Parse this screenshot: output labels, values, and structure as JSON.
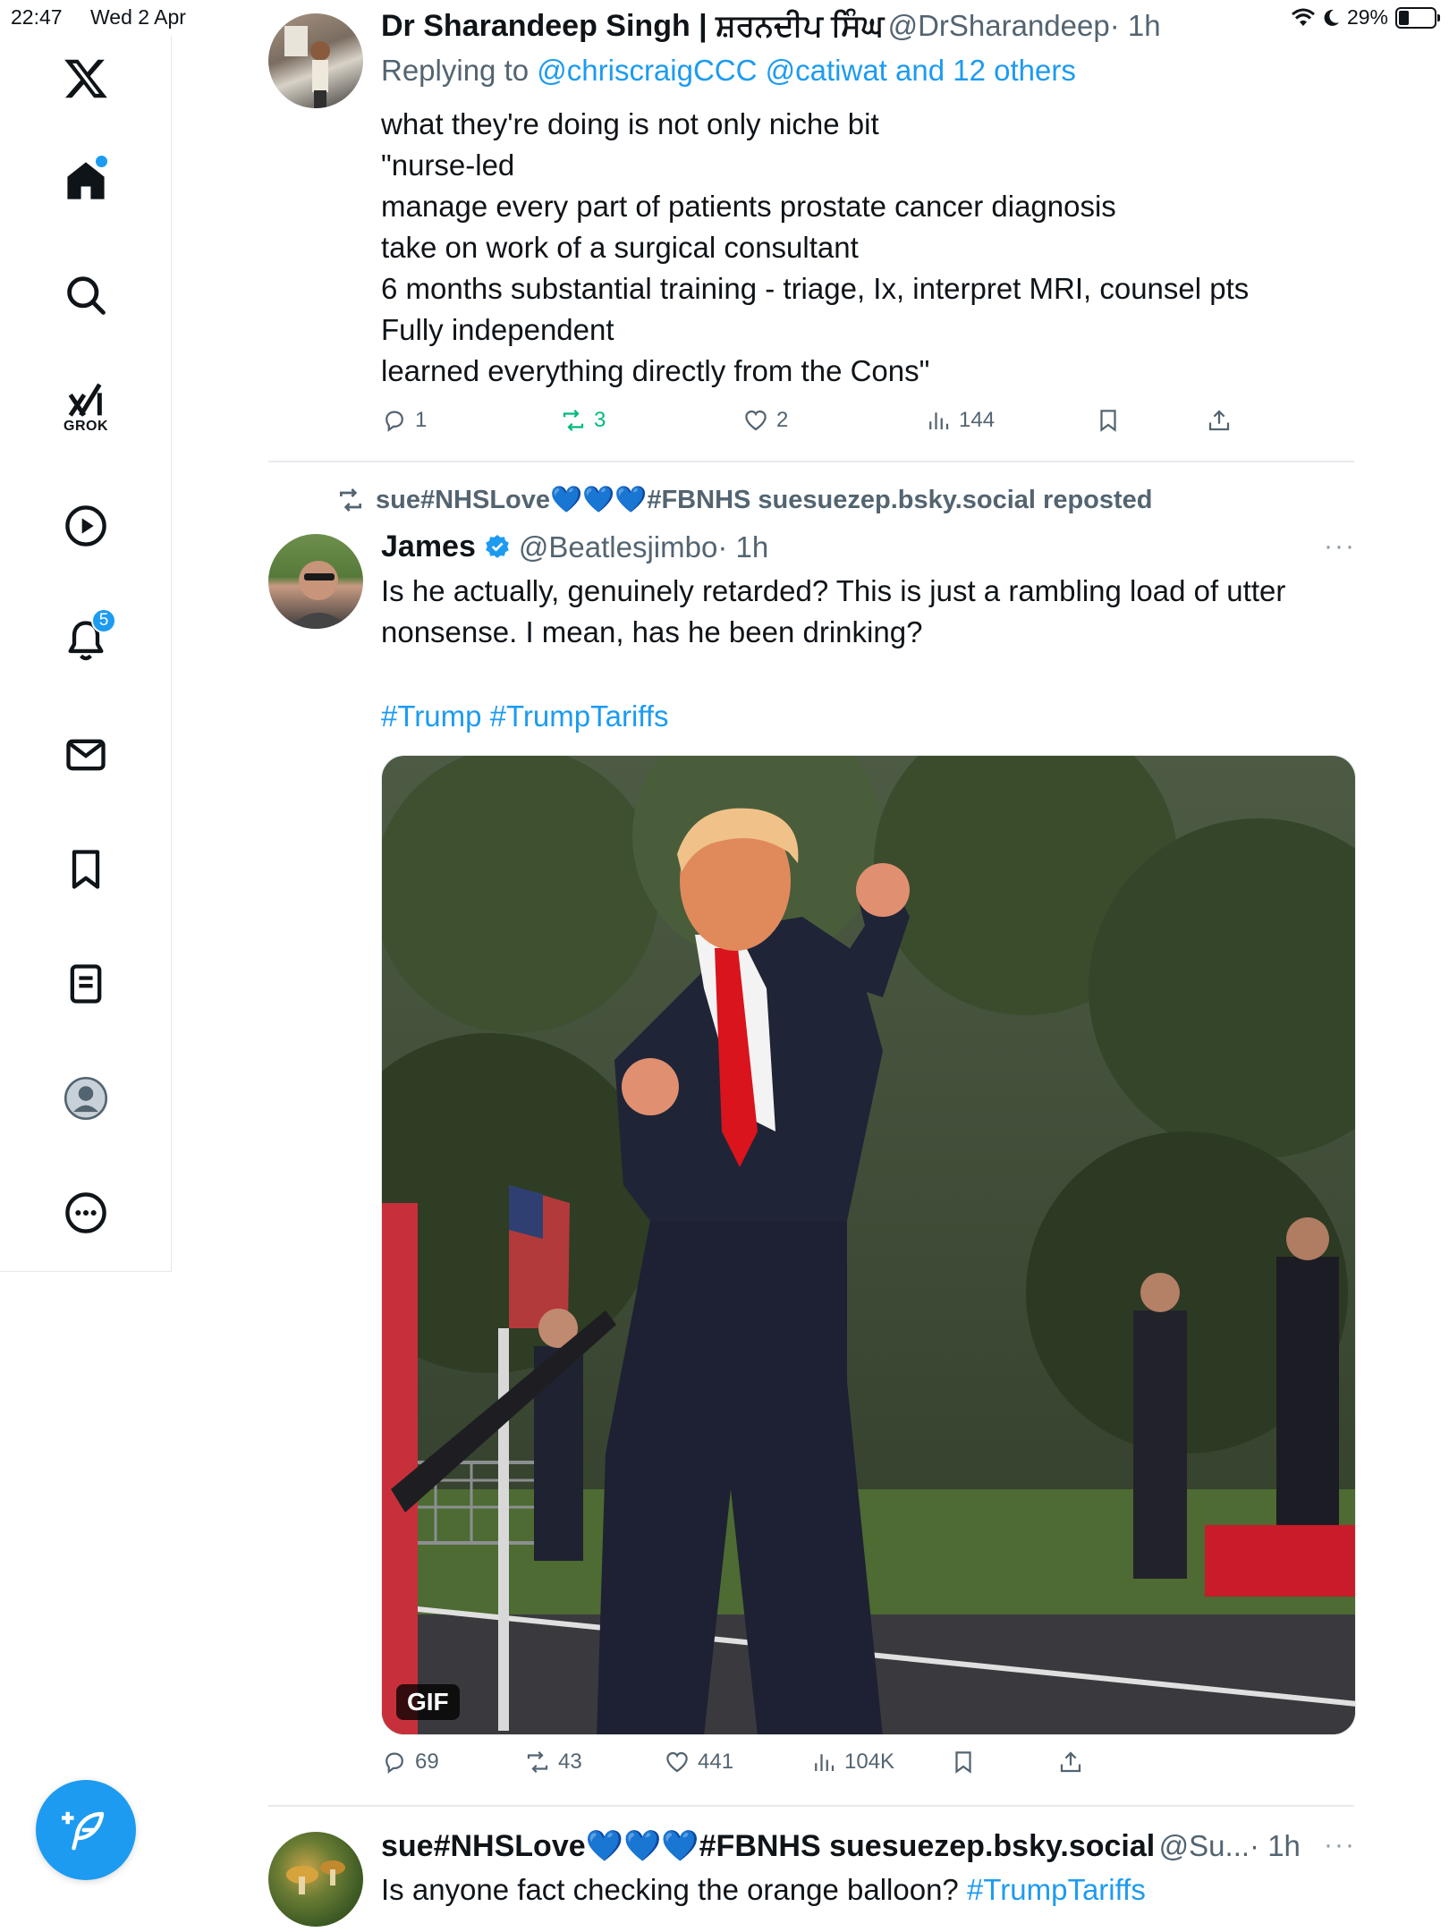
{
  "status": {
    "time": "22:47",
    "date": "Wed 2 Apr",
    "battery": "29%",
    "battery_level": 0.29
  },
  "nav": {
    "grok_label": "GROK",
    "notifications_count": "5"
  },
  "tweets": [
    {
      "name": "Dr Sharandeep Singh | ਸ਼ਰਨਦੀਪ ਸਿੰਘ",
      "handle": "@DrSharandeep",
      "time": "· 1h",
      "reply_prefix": "Replying to ",
      "reply_to": "@chriscraigCCC @catiwat and 12 others",
      "text": "what they're doing is not only niche bit\n\"nurse-led\nmanage every part of patients prostate cancer diagnosis\ntake on work of a surgical consultant\n6 months substantial training - triage, Ix, interpret MRI, counsel pts\nFully independent\nlearned everything directly from the Cons\"",
      "replies": "1",
      "reposts": "3",
      "likes": "2",
      "views": "144"
    },
    {
      "repost_label": "sue#NHSLove💙💙💙#FBNHS suesuezep.bsky.social reposted",
      "name": "James",
      "handle": "@Beatlesjimbo",
      "time": "· 1h",
      "text": "Is he actually, genuinely retarded? This is just a rambling load of utter nonsense. I mean, has he been drinking?",
      "hashtags": "#Trump #TrumpTariffs",
      "media_badge": "GIF",
      "replies": "69",
      "reposts": "43",
      "likes": "441",
      "views": "104K",
      "more": "···"
    },
    {
      "name": "sue#NHSLove💙💙💙#FBNHS suesuezep.bsky.social",
      "handle": "@Su...",
      "time": "· 1h",
      "text": "Is anyone fact checking the orange balloon? ",
      "hashtag": "#TrumpTariffs",
      "more": "···"
    }
  ]
}
